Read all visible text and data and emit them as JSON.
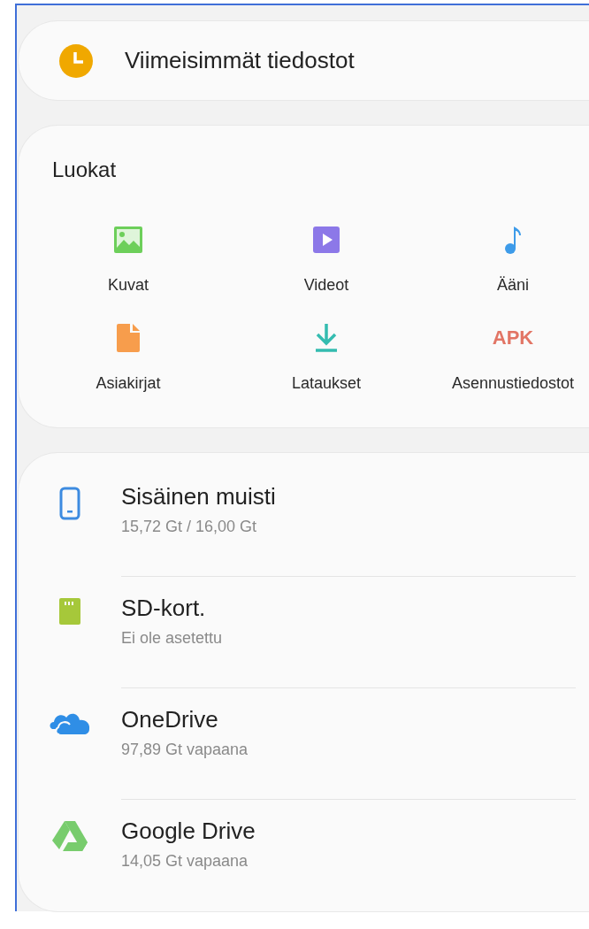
{
  "recent": {
    "label": "Viimeisimmät tiedostot"
  },
  "categories": {
    "title": "Luokat",
    "items": [
      {
        "kind": "image",
        "label": "Kuvat"
      },
      {
        "kind": "video",
        "label": "Videot"
      },
      {
        "kind": "audio",
        "label": "Ääni"
      },
      {
        "kind": "document",
        "label": "Asiakirjat"
      },
      {
        "kind": "download",
        "label": "Lataukset"
      },
      {
        "kind": "apk",
        "icon_text": "APK",
        "label": "Asennustiedostot"
      }
    ]
  },
  "storage": [
    {
      "kind": "phone",
      "name": "Sisäinen muisti",
      "detail": "15,72 Gt / 16,00 Gt"
    },
    {
      "kind": "sdcard",
      "name": "SD-kort.",
      "detail": "Ei ole asetettu"
    },
    {
      "kind": "cloud",
      "name": "OneDrive",
      "detail": "97,89 Gt vapaana"
    },
    {
      "kind": "drive",
      "name": "Google Drive",
      "detail": "14,05 Gt vapaana"
    }
  ]
}
